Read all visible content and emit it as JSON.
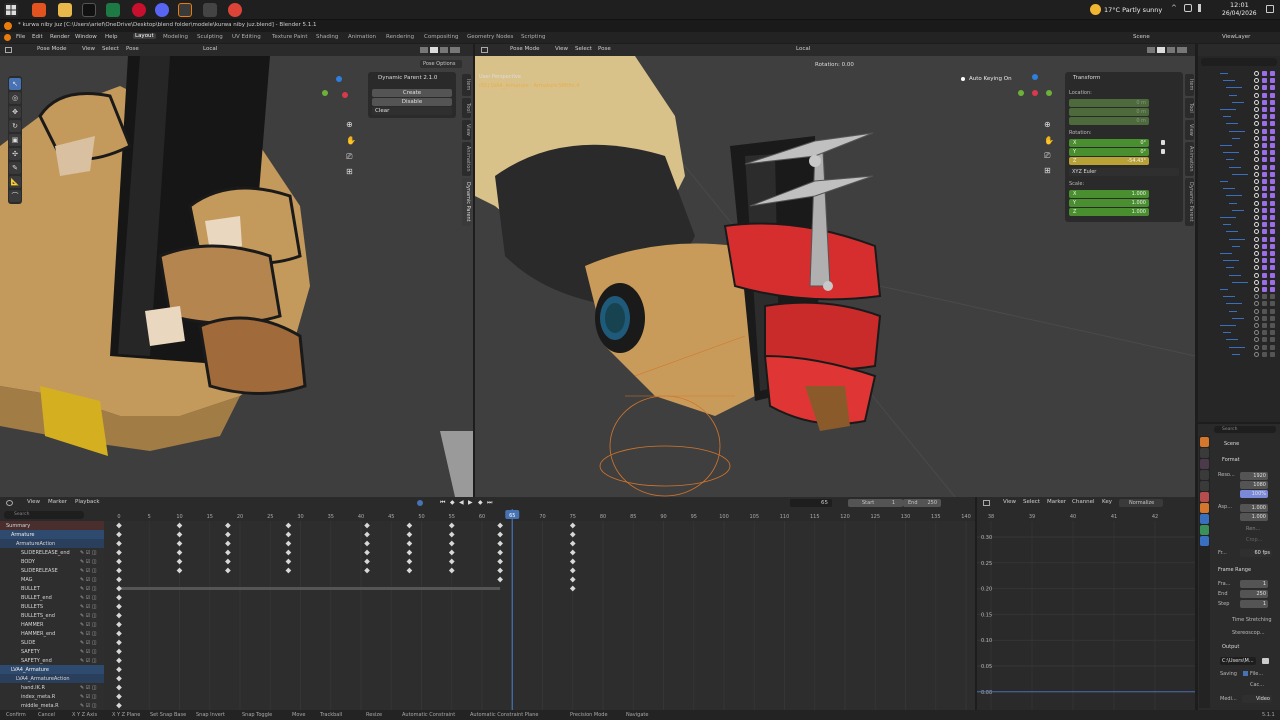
{
  "taskbar": {
    "weather": "17°C  Partly sunny",
    "time": "12:01",
    "date": "26/04/2026"
  },
  "window": {
    "title": "* kurwa niby juz [C:\\Users\\arief\\OneDrive\\Desktop\\blend folder\\modele\\kurwa niby juz.blend] - Blender 5.1.1"
  },
  "menubar": {
    "items": [
      "File",
      "Edit",
      "Render",
      "Window",
      "Help"
    ],
    "workspaces": [
      "Layout",
      "Modeling",
      "Sculpting",
      "UV Editing",
      "Texture Paint",
      "Shading",
      "Animation",
      "Rendering",
      "Compositing",
      "Geometry Nodes",
      "Scripting"
    ],
    "active_workspace": "Layout",
    "scene": "Scene",
    "view_layer": "ViewLayer"
  },
  "left_viewport": {
    "mode": "Pose Mode",
    "menus": [
      "View",
      "Select",
      "Pose"
    ],
    "orientation": "Local",
    "panel_title": "Dynamic Parent 2.1.0",
    "panel_options": "Pose Options",
    "btn_create": "Create",
    "btn_disable": "Disable",
    "clear_label": "Clear",
    "side_tabs": [
      "Item",
      "Tool",
      "View",
      "Animation",
      "Dynamic Parent"
    ]
  },
  "right_viewport": {
    "mode": "Pose Mode",
    "menus": [
      "View",
      "Select",
      "Pose"
    ],
    "orientation": "Local",
    "rotation_readout": "Rotation: 0.00",
    "perspective_label": "User Perspective",
    "object_label": "(65) LVA4_Armature : Armature:SMHhl.4",
    "auto_keying": "Auto Keying On",
    "transform": {
      "title": "Transform",
      "location_label": "Location:",
      "location": [
        {
          "axis": "X",
          "value": "0 m"
        },
        {
          "axis": "Y",
          "value": "0 m"
        },
        {
          "axis": "Z",
          "value": "0 m"
        }
      ],
      "rotation_label": "Rotation:",
      "rotation": [
        {
          "axis": "X",
          "value": "0°"
        },
        {
          "axis": "Y",
          "value": "0°"
        },
        {
          "axis": "Z",
          "value": "-54.43°"
        }
      ],
      "rotation_mode": "XYZ Euler",
      "scale_label": "Scale:",
      "scale": [
        {
          "axis": "X",
          "value": "1.000"
        },
        {
          "axis": "Y",
          "value": "1.000"
        },
        {
          "axis": "Z",
          "value": "1.000"
        }
      ]
    },
    "side_tabs": [
      "Item",
      "Tool",
      "View",
      "Animation",
      "Dynamic Parent"
    ]
  },
  "dopesheet": {
    "menus": [
      "View",
      "Marker",
      "Playback"
    ],
    "current_frame": "65",
    "start_label": "Start",
    "start": "1",
    "end_label": "End",
    "end": "250",
    "search_placeholder": "Search",
    "ruler": [
      "0",
      "5",
      "10",
      "15",
      "20",
      "25",
      "30",
      "35",
      "40",
      "45",
      "50",
      "55",
      "60",
      "65",
      "70",
      "75",
      "80",
      "85",
      "90",
      "95",
      "100",
      "105",
      "110",
      "115",
      "120",
      "125",
      "130",
      "135",
      "140"
    ],
    "channels": [
      {
        "name": "Summary",
        "level": 0,
        "color": "#4a2d2d",
        "key": "summary"
      },
      {
        "name": "Armature",
        "level": 1,
        "color": "#2e4a6e",
        "key": "object"
      },
      {
        "name": "ArmatureAction",
        "level": 2,
        "color": "#2a3f5c",
        "key": "action"
      },
      {
        "name": "SLIDERELEASE_end",
        "level": 3,
        "color": "#2e2e2e",
        "key": "ch"
      },
      {
        "name": "BODY",
        "level": 3,
        "color": "#2e2e2e",
        "key": "ch"
      },
      {
        "name": "SLIDERELEASE",
        "level": 3,
        "color": "#2e2e2e",
        "key": "ch"
      },
      {
        "name": "MAG",
        "level": 3,
        "color": "#2e2e2e",
        "key": "ch"
      },
      {
        "name": "BULLET",
        "level": 3,
        "color": "#2e2e2e",
        "key": "ch"
      },
      {
        "name": "BULLET_end",
        "level": 3,
        "color": "#2e2e2e",
        "key": "ch"
      },
      {
        "name": "BULLETS",
        "level": 3,
        "color": "#2e2e2e",
        "key": "ch"
      },
      {
        "name": "BULLETS_end",
        "level": 3,
        "color": "#2e2e2e",
        "key": "ch"
      },
      {
        "name": "HAMMER",
        "level": 3,
        "color": "#2e2e2e",
        "key": "ch"
      },
      {
        "name": "HAMMER_end",
        "level": 3,
        "color": "#2e2e2e",
        "key": "ch"
      },
      {
        "name": "SLIDE",
        "level": 3,
        "color": "#2e2e2e",
        "key": "ch"
      },
      {
        "name": "SAFETY",
        "level": 3,
        "color": "#2e2e2e",
        "key": "ch"
      },
      {
        "name": "SAFETY_end",
        "level": 3,
        "color": "#2e2e2e",
        "key": "ch"
      },
      {
        "name": "LVA4_Armature",
        "level": 1,
        "color": "#2e4a6e",
        "key": "object"
      },
      {
        "name": "LVA4_ArmatureAction",
        "level": 2,
        "color": "#2a3f5c",
        "key": "action"
      },
      {
        "name": "hand.IK.R",
        "level": 3,
        "color": "#2e2e2e",
        "key": "ch"
      },
      {
        "name": "index_meta.R",
        "level": 3,
        "color": "#2e2e2e",
        "key": "ch"
      },
      {
        "name": "middle_meta.R",
        "level": 3,
        "color": "#2e2e2e",
        "key": "ch"
      }
    ]
  },
  "graph_editor": {
    "menus": [
      "View",
      "Select",
      "Marker",
      "Channel",
      "Key"
    ],
    "normalize": "Normalize",
    "ruler": [
      "38",
      "39",
      "40",
      "41",
      "42"
    ],
    "y_ticks": [
      "0.30",
      "0.25",
      "0.20",
      "0.15",
      "0.10",
      "0.05",
      "0.00"
    ]
  },
  "properties": {
    "search_placeholder": "Search",
    "scene_label": "Scene",
    "format_title": "Format",
    "reso_label": "Reso...",
    "res_x": "1920",
    "res_y": "1080",
    "res_pct": "100%",
    "aspect_label": "Asp...",
    "aspect_x": "1.000",
    "aspect_y": "1.000",
    "render_region": "Ren...",
    "crop": "Crop...",
    "frame_rate_label": "Fr...",
    "frame_rate": "60 fps",
    "frame_range_title": "Frame Range",
    "frame_start_label": "Fra...",
    "frame_start": "1",
    "end_label": "End",
    "end": "250",
    "step_label": "Step",
    "step": "1",
    "time_stretching": "Time Stretching",
    "stereoscopy": "Stereoscop...",
    "output_title": "Output",
    "output_path": "C:\\Users\\M...",
    "saving_label": "Saving",
    "file_ext": "File...",
    "cache": "Cac...",
    "media_label": "Medi...",
    "media_value": "Video"
  },
  "statusbar": {
    "items": [
      "Confirm",
      "Cancel",
      "X Y Z Axis",
      "X Y Z Plane",
      "Set Snap Base",
      "Snap Invert",
      "Snap Toggle",
      "Move",
      "Trackball",
      "Resize",
      "Automatic Constraint",
      "Automatic Constraint Plane",
      "Precision Mode",
      "Navigate"
    ],
    "version": "5.1.1"
  }
}
